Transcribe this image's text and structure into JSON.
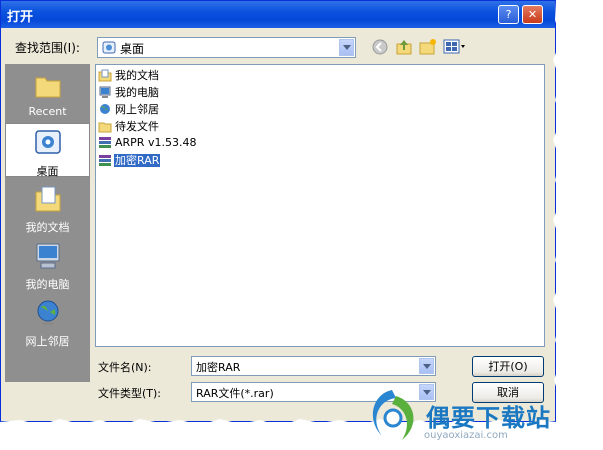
{
  "window": {
    "title": "打开"
  },
  "lookin": {
    "label": "查找范围(I):",
    "value": "桌面"
  },
  "places": [
    {
      "label": "Recent",
      "icon": "recent-folder-icon"
    },
    {
      "label": "桌面",
      "icon": "desktop-icon"
    },
    {
      "label": "我的文档",
      "icon": "my-documents-icon"
    },
    {
      "label": "我的电脑",
      "icon": "my-computer-icon"
    },
    {
      "label": "网上邻居",
      "icon": "network-places-icon"
    }
  ],
  "files": [
    {
      "name": "我的文档",
      "icon": "my-documents-icon"
    },
    {
      "name": "我的电脑",
      "icon": "my-computer-icon"
    },
    {
      "name": "网上邻居",
      "icon": "network-places-icon"
    },
    {
      "name": "待发文件",
      "icon": "folder-icon"
    },
    {
      "name": "ARPR v1.53.48",
      "icon": "rar-archive-icon"
    },
    {
      "name": "加密RAR",
      "icon": "rar-archive-icon",
      "selected": true
    }
  ],
  "filename": {
    "label": "文件名(N):",
    "value": "加密RAR"
  },
  "filetype": {
    "label": "文件类型(T):",
    "value": "RAR文件(*.rar)"
  },
  "buttons": {
    "open": "打开(O)",
    "cancel": "取消"
  },
  "watermark": {
    "text": "偶要下载站",
    "url": "ouyaoxiazai.com"
  },
  "colors": {
    "titlebar": "#0a52df",
    "selection": "#316ac5",
    "dialog": "#ece9d8",
    "watermark": "#1a78c2"
  }
}
